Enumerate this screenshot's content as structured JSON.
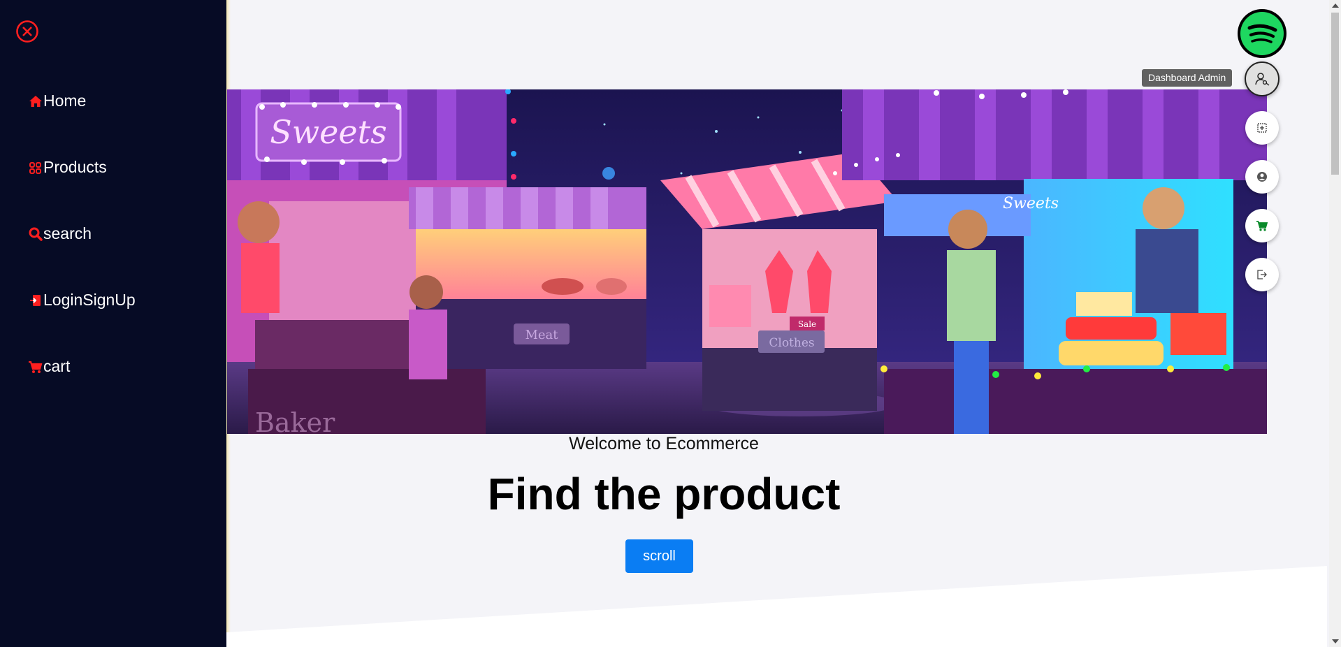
{
  "sidebar": {
    "items": [
      {
        "label": "Home",
        "icon": "home-icon"
      },
      {
        "label": "Products",
        "icon": "grid-icon"
      },
      {
        "label": "search",
        "icon": "search-icon"
      },
      {
        "label": "LoginSignUp",
        "icon": "login-icon"
      },
      {
        "label": "cart",
        "icon": "cart-icon"
      }
    ],
    "close_icon": "close-circle-icon"
  },
  "banner": {
    "signs": {
      "sweets": "Sweets",
      "sweets_small": "Sweets",
      "meat": "Meat",
      "clothes": "Clothes",
      "sale": "Sale",
      "bakery": "Baker"
    }
  },
  "hero": {
    "welcome": "Welcome to Ecommerce",
    "headline": "Find the product",
    "scroll_button": "scroll"
  },
  "speed_dial": {
    "tooltip": "Dashboard Admin",
    "actions": [
      "dashboard-icon",
      "orders-icon",
      "account-icon",
      "cart-icon",
      "logout-icon"
    ]
  },
  "colors": {
    "sidebar_bg": "#060b25",
    "accent_red": "#ff1f1f",
    "button_blue": "#0a7df3",
    "spotify_green": "#1ed760",
    "cart_green": "#0a8a2a"
  }
}
